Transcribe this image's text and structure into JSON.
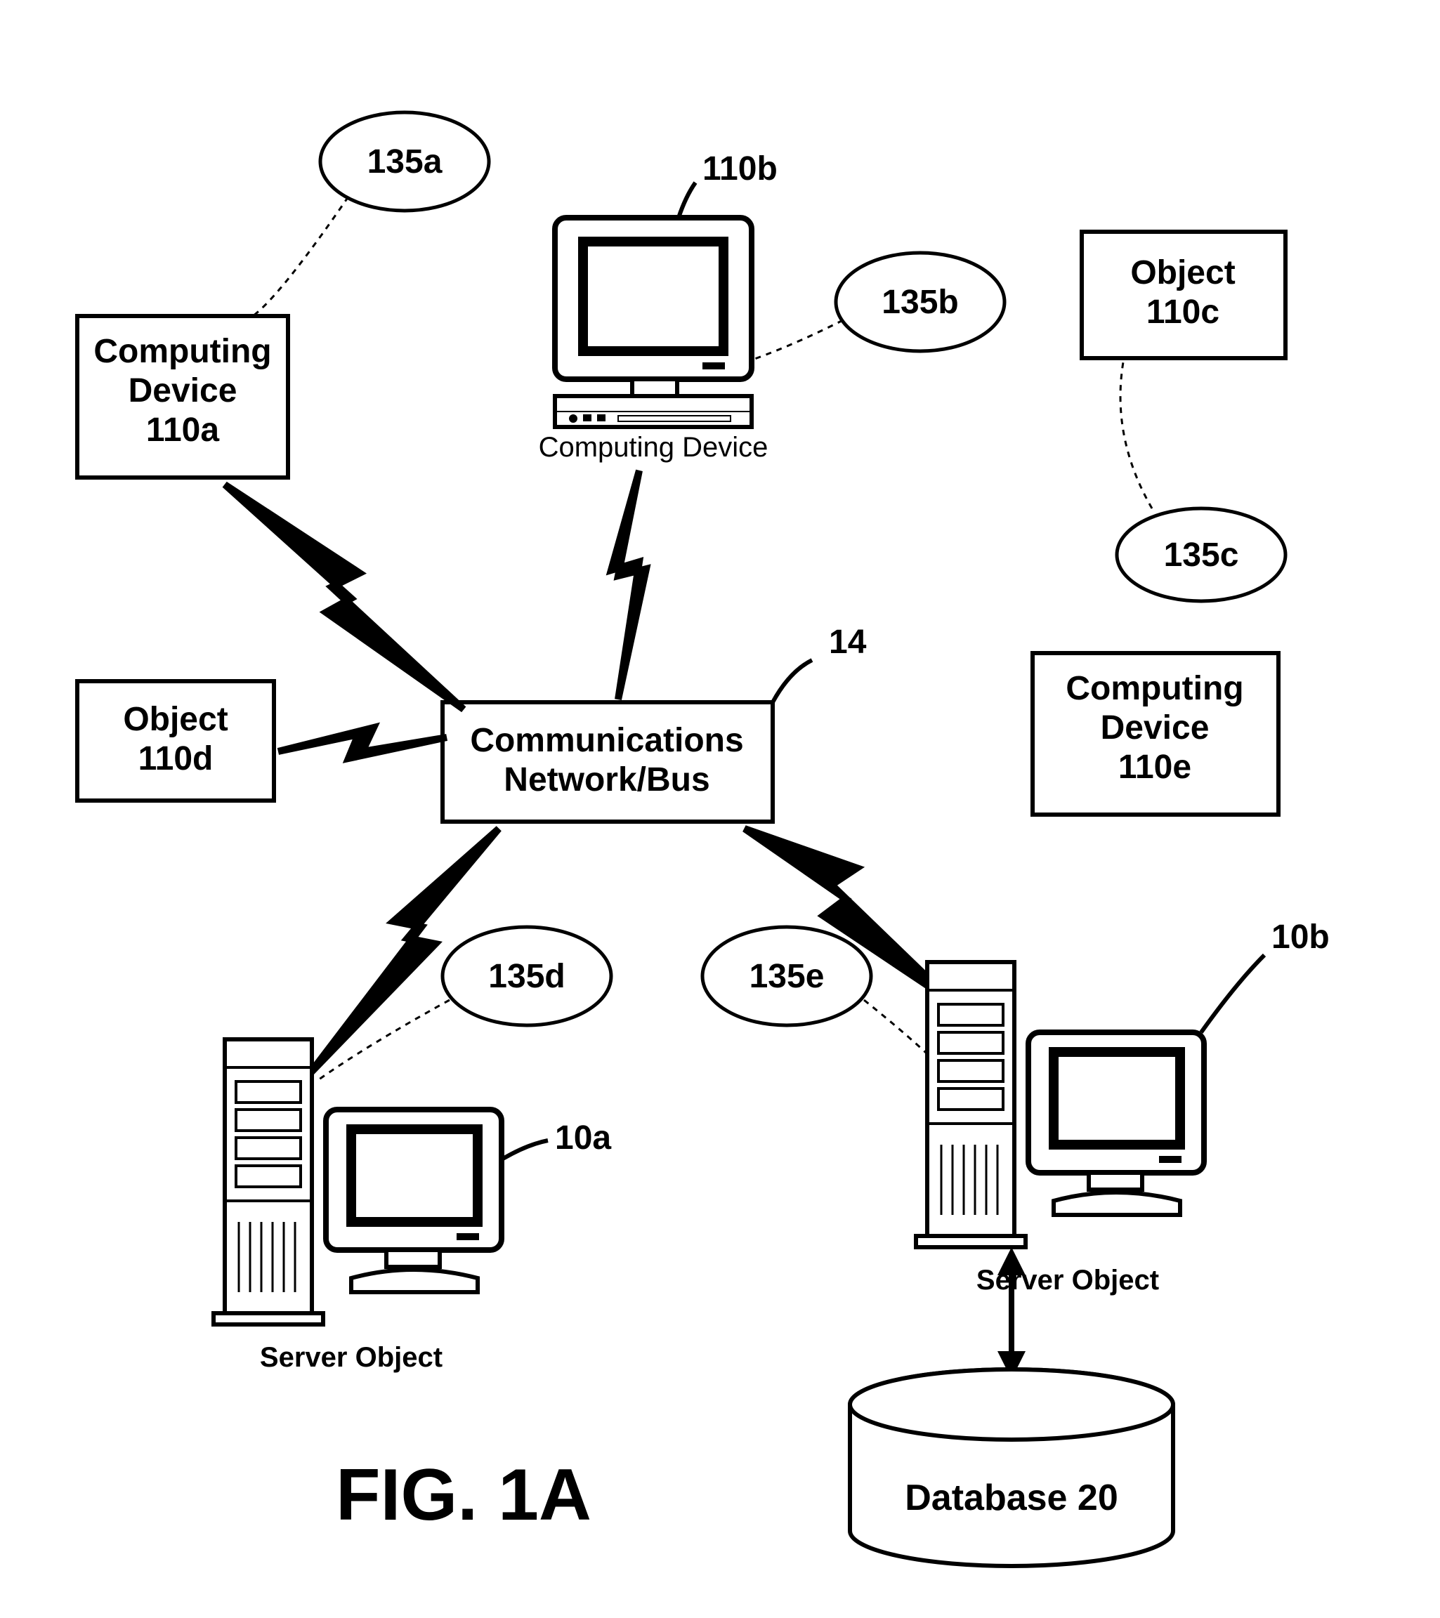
{
  "nodes": {
    "computing_device_110a": {
      "line1": "Computing",
      "line2": "Device",
      "line3": "110a"
    },
    "object_110d": {
      "line1": "Object",
      "line2": "110d"
    },
    "computing_device_110b": {
      "caption": "Computing Device",
      "ref": "110b"
    },
    "object_110c": {
      "line1": "Object",
      "line2": "110c"
    },
    "computing_device_110e": {
      "line1": "Computing",
      "line2": "Device",
      "line3": "110e"
    },
    "network_bus": {
      "line1": "Communications",
      "line2": "Network/Bus",
      "ref": "14"
    },
    "server_object_10a": {
      "caption": "Server Object",
      "ref": "10a"
    },
    "server_object_10b": {
      "caption": "Server Object",
      "ref": "10b"
    },
    "database": {
      "label": "Database 20"
    }
  },
  "ellipses": {
    "e135a": "135a",
    "e135b": "135b",
    "e135c": "135c",
    "e135d": "135d",
    "e135e": "135e"
  },
  "figure_label": "FIG. 1A"
}
